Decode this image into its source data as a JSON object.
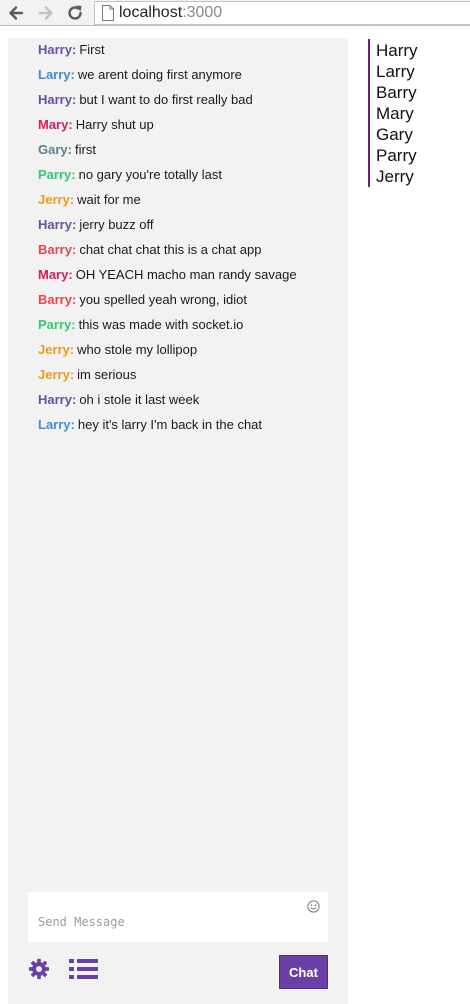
{
  "browser": {
    "url_host": "localhost",
    "url_port": ":3000"
  },
  "messages": [
    {
      "author": "Harry",
      "text": "First",
      "color": "#6b4fa0"
    },
    {
      "author": "Larry",
      "text": "we arent doing first anymore",
      "color": "#3c8fd9"
    },
    {
      "author": "Harry",
      "text": "but I want to do first really bad",
      "color": "#6b4fa0"
    },
    {
      "author": "Mary",
      "text": "Harry shut up",
      "color": "#d81b5c"
    },
    {
      "author": "Gary",
      "text": "first",
      "color": "#5f7f8f"
    },
    {
      "author": "Parry",
      "text": "no gary you're totally last",
      "color": "#2ecc71"
    },
    {
      "author": "Jerry",
      "text": "wait for me",
      "color": "#f09a1a"
    },
    {
      "author": "Harry",
      "text": "jerry buzz off",
      "color": "#6b4fa0"
    },
    {
      "author": "Barry",
      "text": "chat chat chat this is a chat app",
      "color": "#e04a4a"
    },
    {
      "author": "Mary",
      "text": "OH YEACH macho man randy savage",
      "color": "#d81b5c"
    },
    {
      "author": "Barry",
      "text": "you spelled yeah wrong, idiot",
      "color": "#e04a4a"
    },
    {
      "author": "Parry",
      "text": "this was made with socket.io",
      "color": "#2ecc71"
    },
    {
      "author": "Jerry",
      "text": "who stole my lollipop",
      "color": "#f09a1a"
    },
    {
      "author": "Jerry",
      "text": "im serious",
      "color": "#f09a1a"
    },
    {
      "author": "Harry",
      "text": "oh i stole it last week",
      "color": "#6b4fa0"
    },
    {
      "author": "Larry",
      "text": "hey it's larry I'm back in the chat",
      "color": "#3c8fd9"
    }
  ],
  "composer": {
    "placeholder": "Send Message",
    "emoji_icon": "smiley-icon",
    "settings_icon": "gear-icon",
    "list_icon": "list-icon",
    "send_label": "Chat",
    "accent_color": "#6a3fa8"
  },
  "users": [
    "Harry",
    "Larry",
    "Barry",
    "Mary",
    "Gary",
    "Parry",
    "Jerry"
  ]
}
